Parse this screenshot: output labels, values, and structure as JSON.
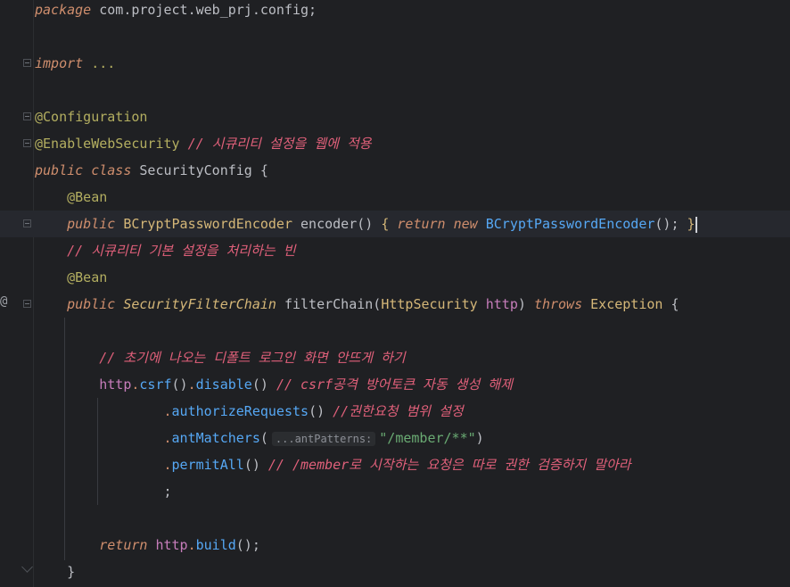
{
  "editor": {
    "lines": [
      {
        "id": "l1",
        "tokens": [
          [
            "kw",
            "package"
          ],
          [
            "cls",
            " com.project.web_prj.config;"
          ]
        ]
      },
      {
        "id": "l2",
        "tokens": []
      },
      {
        "id": "l3",
        "tokens": [
          [
            "kw",
            "import"
          ],
          [
            "cls",
            " "
          ],
          [
            "ann",
            "..."
          ]
        ]
      },
      {
        "id": "l4",
        "tokens": []
      },
      {
        "id": "l5",
        "tokens": [
          [
            "ann",
            "@Configuration"
          ]
        ]
      },
      {
        "id": "l6",
        "tokens": [
          [
            "ann",
            "@EnableWebSecurity"
          ],
          [
            "cls",
            " "
          ],
          [
            "cmt",
            "// 시큐리티 설정을 웹에 적용"
          ]
        ]
      },
      {
        "id": "l7",
        "tokens": [
          [
            "kw",
            "public class"
          ],
          [
            "cls",
            " SecurityConfig {"
          ]
        ]
      },
      {
        "id": "l8",
        "tokens": [
          [
            "cls",
            "    "
          ],
          [
            "ann",
            "@Bean"
          ]
        ]
      },
      {
        "id": "l9",
        "tokens": [
          [
            "cls",
            "    "
          ],
          [
            "kw",
            "public"
          ],
          [
            "cls",
            " "
          ],
          [
            "typ",
            "BCryptPasswordEncoder"
          ],
          [
            "cls",
            " encoder() "
          ],
          [
            "typ",
            "{"
          ],
          [
            "cls",
            " "
          ],
          [
            "kw",
            "return new"
          ],
          [
            "cls",
            " "
          ],
          [
            "fn",
            "BCryptPasswordEncoder"
          ],
          [
            "cls",
            "(); "
          ],
          [
            "typ",
            "}"
          ]
        ]
      },
      {
        "id": "l10",
        "tokens": [
          [
            "cls",
            "    "
          ],
          [
            "cmt",
            "// 시큐리티 기본 설정을 처리하는 빈"
          ]
        ]
      },
      {
        "id": "l11",
        "tokens": [
          [
            "cls",
            "    "
          ],
          [
            "ann",
            "@Bean"
          ]
        ]
      },
      {
        "id": "l12",
        "tokens": [
          [
            "cls",
            "    "
          ],
          [
            "kw",
            "public"
          ],
          [
            "cls",
            " "
          ],
          [
            "typi",
            "SecurityFilterChain"
          ],
          [
            "cls",
            " filterChain("
          ],
          [
            "typ",
            "HttpSecurity"
          ],
          [
            "cls",
            " "
          ],
          [
            "var",
            "http"
          ],
          [
            "cls",
            ") "
          ],
          [
            "kw",
            "throws"
          ],
          [
            "cls",
            " "
          ],
          [
            "typ",
            "Exception"
          ],
          [
            "cls",
            " {"
          ]
        ]
      },
      {
        "id": "l13",
        "tokens": []
      },
      {
        "id": "l14",
        "tokens": [
          [
            "cls",
            "        "
          ],
          [
            "cmt",
            "// 초기에 나오는 디폴트 로그인 화면 안뜨게 하기"
          ]
        ]
      },
      {
        "id": "l15",
        "tokens": [
          [
            "cls",
            "        "
          ],
          [
            "var",
            "http"
          ],
          [
            "dot",
            "."
          ],
          [
            "fn",
            "csrf"
          ],
          [
            "cls",
            "()"
          ],
          [
            "dot",
            "."
          ],
          [
            "fn",
            "disable"
          ],
          [
            "cls",
            "() "
          ],
          [
            "cmt",
            "// csrf공격 방어토큰 자동 생성 해제"
          ]
        ]
      },
      {
        "id": "l16",
        "tokens": [
          [
            "cls",
            "                "
          ],
          [
            "dot",
            "."
          ],
          [
            "fn",
            "authorizeRequests"
          ],
          [
            "cls",
            "() "
          ],
          [
            "cmt",
            "//권한요청 범위 설정"
          ]
        ]
      },
      {
        "id": "l17",
        "tokens": [
          [
            "cls",
            "                "
          ],
          [
            "dot",
            "."
          ],
          [
            "fn",
            "antMatchers"
          ],
          [
            "cls",
            "("
          ],
          [
            "hint",
            "...antPatterns:"
          ],
          [
            "str",
            "\"/member/**\""
          ],
          [
            "cls",
            ")"
          ]
        ]
      },
      {
        "id": "l18",
        "tokens": [
          [
            "cls",
            "                "
          ],
          [
            "dot",
            "."
          ],
          [
            "fn",
            "permitAll"
          ],
          [
            "cls",
            "() "
          ],
          [
            "cmt",
            "// /member로 시작하는 요청은 따로 권한 검증하지 말아라"
          ]
        ]
      },
      {
        "id": "l19",
        "tokens": [
          [
            "cls",
            "                ;"
          ]
        ]
      },
      {
        "id": "l20",
        "tokens": []
      },
      {
        "id": "l21",
        "tokens": [
          [
            "cls",
            "        "
          ],
          [
            "kw",
            "return"
          ],
          [
            "cls",
            " "
          ],
          [
            "var",
            "http"
          ],
          [
            "dot",
            "."
          ],
          [
            "fn",
            "build"
          ],
          [
            "cls",
            "();"
          ]
        ]
      },
      {
        "id": "l22",
        "tokens": [
          [
            "cls",
            "    }"
          ]
        ]
      }
    ]
  },
  "gutter": {
    "override_marker": "@"
  },
  "colors": {
    "background": "#1f2023",
    "current_line": "#26282e",
    "keyword": "#cf8e6d",
    "annotation": "#b3ae60",
    "comment": "#e0607a",
    "string": "#6aab73",
    "function": "#56a8f5",
    "type": "#d5b778",
    "field": "#c77dbb"
  }
}
